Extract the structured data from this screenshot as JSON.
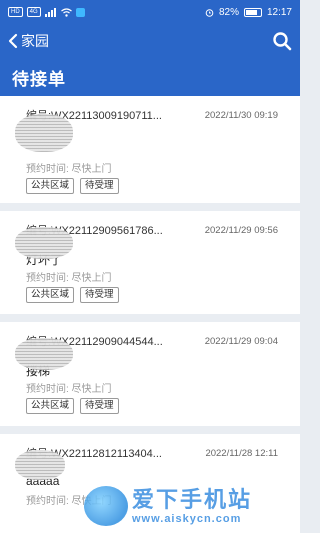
{
  "status_bar": {
    "chips": [
      "HD",
      "4G"
    ],
    "battery_text": "82%",
    "battery_level": 0.82,
    "time": "12:17"
  },
  "nav": {
    "back_label": "家园",
    "icons": {
      "back": "chevron-left-icon",
      "search": "search-icon"
    }
  },
  "page": {
    "title": "待接单"
  },
  "orders": [
    {
      "order_no": "编号:WX22113009190711...",
      "date": "2022/11/30 09:19",
      "address": "",
      "appointment": "预约时间:    尽快上门",
      "tags": [
        "公共区域",
        "待受理"
      ]
    },
    {
      "order_no": "编号:WX22112909561786...",
      "date": "2022/11/29 09:56",
      "address": "灯坏了",
      "appointment": "预约时间:    尽快上门",
      "tags": [
        "公共区域",
        "待受理"
      ]
    },
    {
      "order_no": "编号:WX22112909044544...",
      "date": "2022/11/29 09:04",
      "address": "搂梯",
      "appointment": "预约时间:    尽快上门",
      "tags": [
        "公共区域",
        "待受理"
      ]
    },
    {
      "order_no": "编号:WX22112812113404...",
      "date": "2022/11/28 12:11",
      "address": "aaaaa",
      "appointment": "预约时间:    尽快上门",
      "tags": []
    }
  ],
  "watermark": {
    "title": "爱下手机站",
    "url": "www.aiskycn.com"
  },
  "colors": {
    "brand_blue": "#2a66c8",
    "background": "#e9edf2"
  }
}
